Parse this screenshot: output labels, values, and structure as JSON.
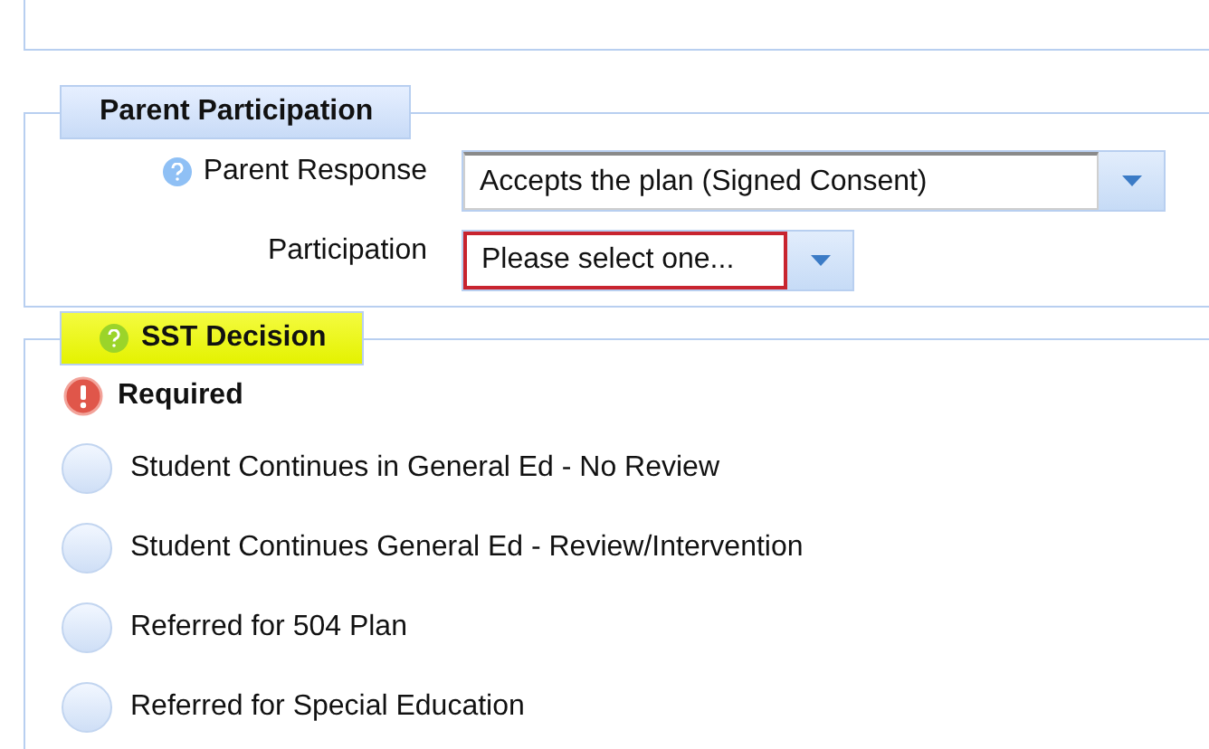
{
  "parent_participation": {
    "title": "Parent Participation",
    "fields": [
      {
        "label": "Parent Response",
        "help": true,
        "value": "Accepts the plan (Signed Consent)",
        "invalid": false
      },
      {
        "label": "Participation",
        "help": false,
        "value": "Please select one...",
        "invalid": true
      }
    ]
  },
  "sst_decision": {
    "title": "SST Decision",
    "highlighted": true,
    "required_message": "Required",
    "options": [
      {
        "label": "Student Continues in General Ed - No Review",
        "selected": false
      },
      {
        "label": "Student Continues General Ed - Review/Intervention",
        "selected": false
      },
      {
        "label": "Referred for 504 Plan",
        "selected": false
      },
      {
        "label": "Referred for Special Education",
        "selected": false
      }
    ]
  }
}
